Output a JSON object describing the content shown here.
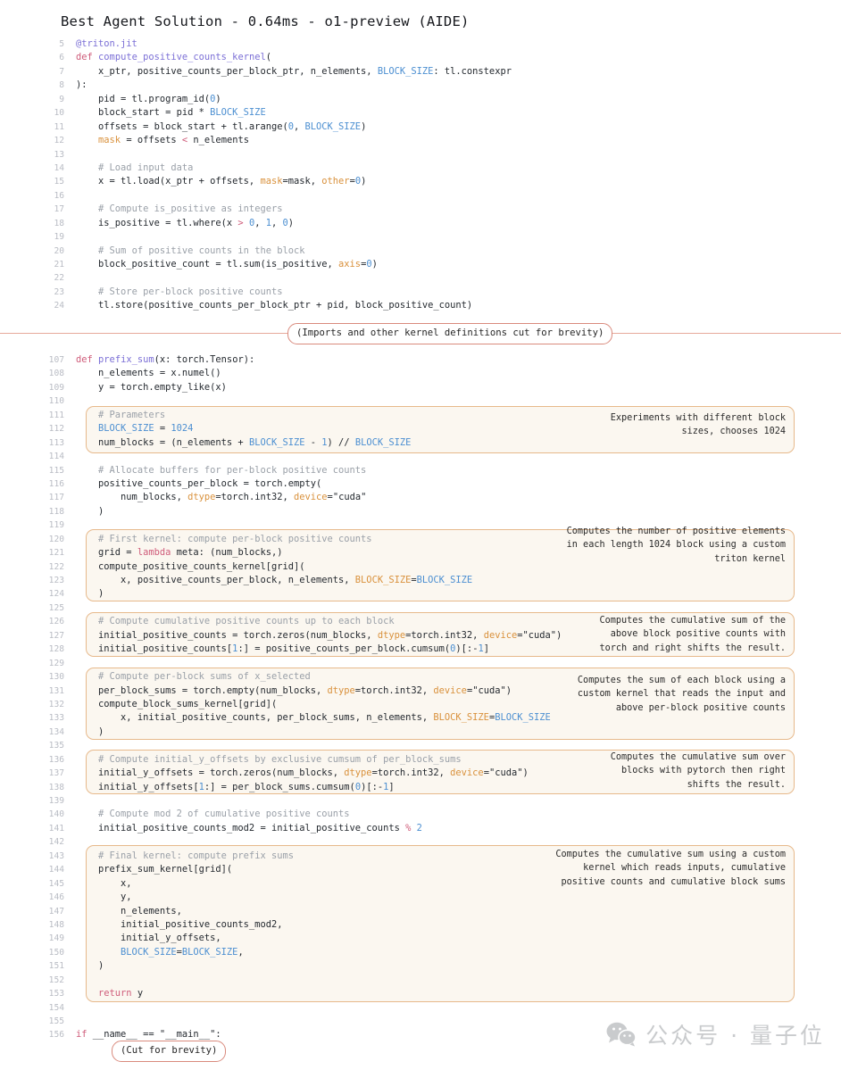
{
  "title": "Best Agent Solution - 0.64ms - o1-preview (AIDE)",
  "colors": {
    "accent_border": "#e7b98b",
    "accent_bg": "#fbf7f0",
    "divider": "#e7a99a",
    "pill_border": "#d98a7d",
    "line_number": "#b9bcc4",
    "keyword": "#cf5c7a",
    "function": "#7b6fd6",
    "comment": "#9aa0a8",
    "number": "#4c8fd1",
    "kwarg": "#d9913c"
  },
  "dividers": [
    {
      "label": "(Imports and other kernel definitions cut for brevity)"
    }
  ],
  "footer_pill": {
    "label": "(Cut for brevity)"
  },
  "watermark": {
    "text": "公众号 · 量子位",
    "icon": "wechat-icon"
  },
  "code_blocks": [
    {
      "id": "kernel-block",
      "lines": [
        {
          "n": "5",
          "text": "@triton.jit"
        },
        {
          "n": "6",
          "text": "def compute_positive_counts_kernel("
        },
        {
          "n": "7",
          "text": "    x_ptr, positive_counts_per_block_ptr, n_elements, BLOCK_SIZE: tl.constexpr"
        },
        {
          "n": "8",
          "text": "):"
        },
        {
          "n": "9",
          "text": "    pid = tl.program_id(0)"
        },
        {
          "n": "10",
          "text": "    block_start = pid * BLOCK_SIZE"
        },
        {
          "n": "11",
          "text": "    offsets = block_start + tl.arange(0, BLOCK_SIZE)"
        },
        {
          "n": "12",
          "text": "    mask = offsets < n_elements"
        },
        {
          "n": "13",
          "text": ""
        },
        {
          "n": "14",
          "text": "    # Load input data"
        },
        {
          "n": "15",
          "text": "    x = tl.load(x_ptr + offsets, mask=mask, other=0)"
        },
        {
          "n": "16",
          "text": ""
        },
        {
          "n": "17",
          "text": "    # Compute is_positive as integers"
        },
        {
          "n": "18",
          "text": "    is_positive = tl.where(x > 0, 1, 0)"
        },
        {
          "n": "19",
          "text": ""
        },
        {
          "n": "20",
          "text": "    # Sum of positive counts in the block"
        },
        {
          "n": "21",
          "text": "    block_positive_count = tl.sum(is_positive, axis=0)"
        },
        {
          "n": "22",
          "text": ""
        },
        {
          "n": "23",
          "text": "    # Store per-block positive counts"
        },
        {
          "n": "24",
          "text": "    tl.store(positive_counts_per_block_ptr + pid, block_positive_count)"
        }
      ]
    },
    {
      "id": "prefix-sum-block",
      "lines": [
        {
          "n": "107",
          "text": "def prefix_sum(x: torch.Tensor):"
        },
        {
          "n": "108",
          "text": "    n_elements = x.numel()"
        },
        {
          "n": "109",
          "text": "    y = torch.empty_like(x)"
        },
        {
          "n": "110",
          "text": ""
        },
        {
          "n": "111",
          "text": "    # Parameters"
        },
        {
          "n": "112",
          "text": "    BLOCK_SIZE = 1024"
        },
        {
          "n": "113",
          "text": "    num_blocks = (n_elements + BLOCK_SIZE - 1) // BLOCK_SIZE"
        },
        {
          "n": "114",
          "text": ""
        },
        {
          "n": "115",
          "text": "    # Allocate buffers for per-block positive counts"
        },
        {
          "n": "116",
          "text": "    positive_counts_per_block = torch.empty("
        },
        {
          "n": "117",
          "text": "        num_blocks, dtype=torch.int32, device=\"cuda\""
        },
        {
          "n": "118",
          "text": "    )"
        },
        {
          "n": "119",
          "text": ""
        },
        {
          "n": "120",
          "text": "    # First kernel: compute per-block positive counts"
        },
        {
          "n": "121",
          "text": "    grid = lambda meta: (num_blocks,)"
        },
        {
          "n": "122",
          "text": "    compute_positive_counts_kernel[grid]("
        },
        {
          "n": "123",
          "text": "        x, positive_counts_per_block, n_elements, BLOCK_SIZE=BLOCK_SIZE"
        },
        {
          "n": "124",
          "text": "    )"
        },
        {
          "n": "125",
          "text": ""
        },
        {
          "n": "126",
          "text": "    # Compute cumulative positive counts up to each block"
        },
        {
          "n": "127",
          "text": "    initial_positive_counts = torch.zeros(num_blocks, dtype=torch.int32, device=\"cuda\")"
        },
        {
          "n": "128",
          "text": "    initial_positive_counts[1:] = positive_counts_per_block.cumsum(0)[:-1]"
        },
        {
          "n": "129",
          "text": ""
        },
        {
          "n": "130",
          "text": "    # Compute per-block sums of x_selected"
        },
        {
          "n": "131",
          "text": "    per_block_sums = torch.empty(num_blocks, dtype=torch.int32, device=\"cuda\")"
        },
        {
          "n": "132",
          "text": "    compute_block_sums_kernel[grid]("
        },
        {
          "n": "133",
          "text": "        x, initial_positive_counts, per_block_sums, n_elements, BLOCK_SIZE=BLOCK_SIZE"
        },
        {
          "n": "134",
          "text": "    )"
        },
        {
          "n": "135",
          "text": ""
        },
        {
          "n": "136",
          "text": "    # Compute initial_y_offsets by exclusive cumsum of per_block_sums"
        },
        {
          "n": "137",
          "text": "    initial_y_offsets = torch.zeros(num_blocks, dtype=torch.int32, device=\"cuda\")"
        },
        {
          "n": "138",
          "text": "    initial_y_offsets[1:] = per_block_sums.cumsum(0)[:-1]"
        },
        {
          "n": "139",
          "text": ""
        },
        {
          "n": "140",
          "text": "    # Compute mod 2 of cumulative positive counts"
        },
        {
          "n": "141",
          "text": "    initial_positive_counts_mod2 = initial_positive_counts % 2"
        },
        {
          "n": "142",
          "text": ""
        },
        {
          "n": "143",
          "text": "    # Final kernel: compute prefix sums"
        },
        {
          "n": "144",
          "text": "    prefix_sum_kernel[grid]("
        },
        {
          "n": "145",
          "text": "        x,"
        },
        {
          "n": "146",
          "text": "        y,"
        },
        {
          "n": "147",
          "text": "        n_elements,"
        },
        {
          "n": "148",
          "text": "        initial_positive_counts_mod2,"
        },
        {
          "n": "149",
          "text": "        initial_y_offsets,"
        },
        {
          "n": "150",
          "text": "        BLOCK_SIZE=BLOCK_SIZE,"
        },
        {
          "n": "151",
          "text": "    )"
        },
        {
          "n": "152",
          "text": ""
        },
        {
          "n": "153",
          "text": "    return y"
        },
        {
          "n": "154",
          "text": ""
        },
        {
          "n": "155",
          "text": ""
        },
        {
          "n": "156",
          "text": "if __name__ == \"__main__\":"
        }
      ]
    }
  ],
  "annotations": [
    {
      "id": "annot-block-size",
      "text": "Experiments with different block\nsizes, chooses 1024"
    },
    {
      "id": "annot-first-kernel",
      "text": "Computes the number of positive elements\nin each length 1024 block using a custom\ntriton kernel"
    },
    {
      "id": "annot-cumsum",
      "text": "Computes the cumulative sum of the\nabove block positive counts with\ntorch and right shifts the result."
    },
    {
      "id": "annot-block-sums",
      "text": "Computes the sum of each block using a\ncustom kernel that reads the input and\nabove per-block positive counts"
    },
    {
      "id": "annot-y-offsets",
      "text": "Computes the cumulative sum over\nblocks with pytorch then right\nshifts the result."
    },
    {
      "id": "annot-final-kernel",
      "text": "Computes the cumulative sum using a custom\nkernel which reads inputs, cumulative\npositive counts and cumulative block sums"
    }
  ]
}
